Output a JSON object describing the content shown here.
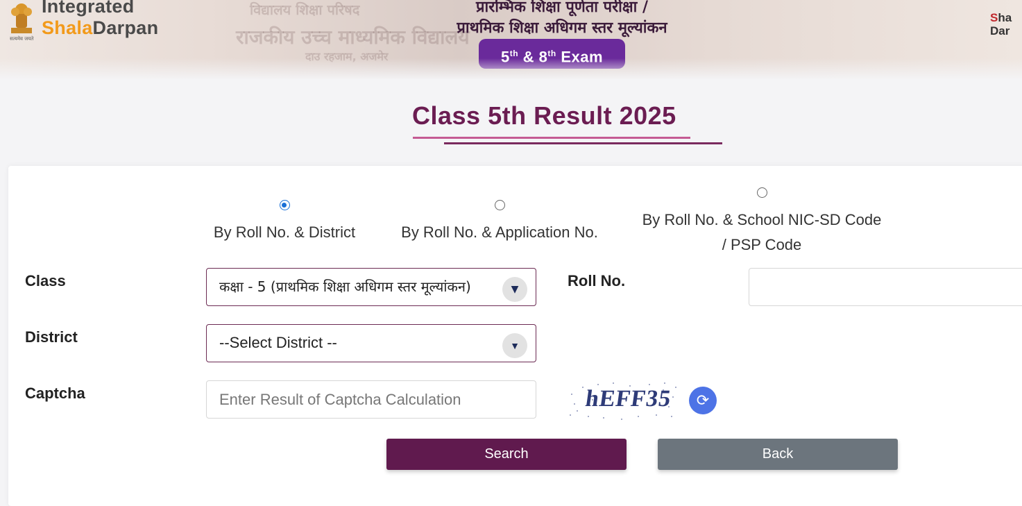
{
  "header": {
    "emblem_caption": "सत्यमेव जयते",
    "logo_line1": "Integrated",
    "logo_line2_a": "Shala",
    "logo_line2_b": "Darpan",
    "hindi_title_line1": "प्रारम्भिक शिक्षा पूर्णता परीक्षा /",
    "hindi_title_line2": "प्राथमिक शिक्षा अधिगम स्तर मूल्यांकन",
    "exam_badge_5": "5",
    "exam_badge_sup1": "th",
    "exam_badge_mid": " & 8",
    "exam_badge_sup2": "th",
    "exam_badge_end": " Exam",
    "corner_logo_line1_a": "S",
    "corner_logo_line1_b": "ha",
    "corner_logo_line2": "Dar",
    "bg_text_1": "विद्यालय शिक्षा परिषद",
    "bg_text_2": "राजकीय उच्च माध्यमिक विद्यालय",
    "bg_text_3": "दाउ रहजाम, अजमेर"
  },
  "page": {
    "title": "Class 5th Result 2025"
  },
  "search_options": [
    {
      "label": "By Roll No. & District",
      "checked": true
    },
    {
      "label": "By Roll No. & Application No.",
      "checked": false
    },
    {
      "label_line1": "By Roll No. & School NIC-SD Code",
      "label_line2": "/ PSP Code",
      "checked": false
    }
  ],
  "form": {
    "class_label": "Class",
    "class_value": "कक्षा - 5 (प्राथमिक शिक्षा अधिगम स्तर मूल्यांकन)",
    "roll_label": "Roll No.",
    "roll_value": "",
    "district_label": "District",
    "district_value": "--Select District --",
    "captcha_label": "Captcha",
    "captcha_placeholder": "Enter Result of Captcha Calculation",
    "captcha_image_text": "hEFF35"
  },
  "buttons": {
    "search": "Search",
    "back": "Back"
  },
  "colors": {
    "title": "#6b1d52",
    "search_button": "#601a4e",
    "back_button": "#6c757d",
    "exam_badge": "#6a2a9b",
    "refresh": "#4d73e6"
  }
}
